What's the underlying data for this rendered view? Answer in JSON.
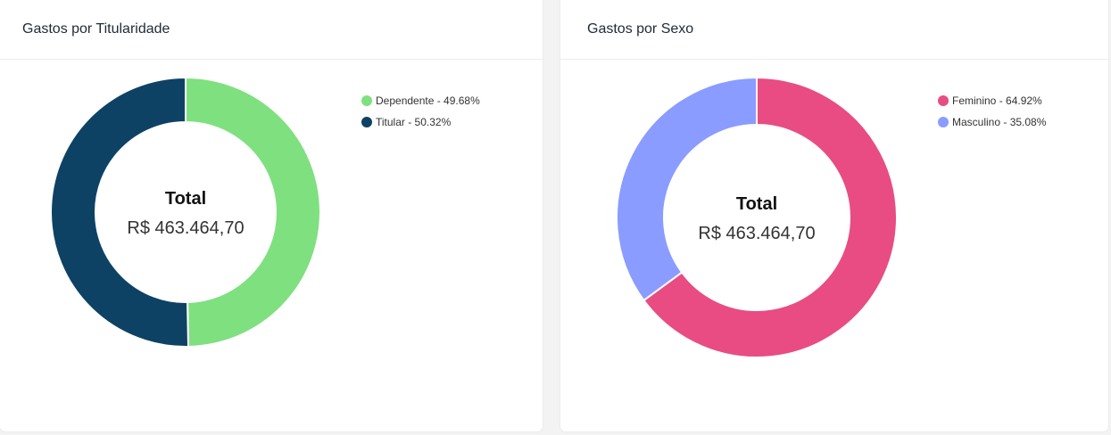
{
  "charts": [
    {
      "title": "Gastos por Titularidade",
      "center_label": "Total",
      "center_value": "R$ 463.464,70",
      "legend": [
        {
          "label": "Dependente - 49.68%",
          "color": "#7fe07f"
        },
        {
          "label": "Titular - 50.32%",
          "color": "#0e4264"
        }
      ]
    },
    {
      "title": "Gastos por Sexo",
      "center_label": "Total",
      "center_value": "R$ 463.464,70",
      "legend": [
        {
          "label": "Feminino - 64.92%",
          "color": "#e84c83"
        },
        {
          "label": "Masculino - 35.08%",
          "color": "#8a9cff"
        }
      ]
    }
  ],
  "chart_data": [
    {
      "type": "pie",
      "title": "Gastos por Titularidade",
      "categories": [
        "Dependente",
        "Titular"
      ],
      "values": [
        49.68,
        50.32
      ],
      "colors": [
        "#7fe07f",
        "#0e4264"
      ],
      "legend_position": "top-right"
    },
    {
      "type": "pie",
      "title": "Gastos por Sexo",
      "categories": [
        "Feminino",
        "Masculino"
      ],
      "values": [
        64.92,
        35.08
      ],
      "colors": [
        "#e84c83",
        "#8a9cff"
      ],
      "legend_position": "top-right"
    }
  ]
}
